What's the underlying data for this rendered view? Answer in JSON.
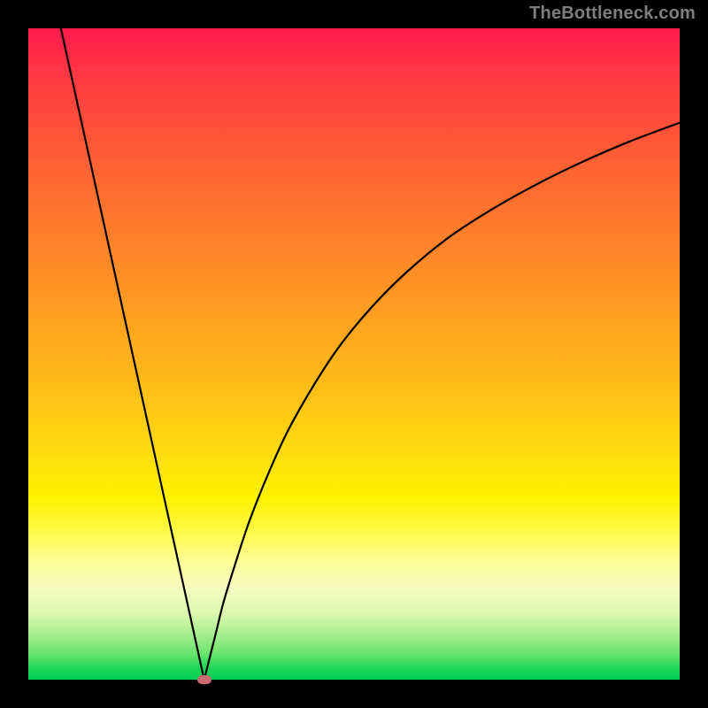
{
  "watermark": "TheBottleneck.com",
  "colors": {
    "frame": "#000000",
    "curve_stroke": "#000000",
    "vertex_fill": "#c96a6c",
    "gradient_top": "#ff1a4d",
    "gradient_bottom": "#00cf55"
  },
  "chart_data": {
    "type": "line",
    "title": "",
    "xlabel": "",
    "ylabel": "",
    "xlim": [
      0,
      100
    ],
    "ylim": [
      0,
      100
    ],
    "grid": false,
    "legend": false,
    "vertex": {
      "x": 27,
      "y": 0
    },
    "series": [
      {
        "name": "left",
        "x": [
          5,
          7.2,
          9.4,
          11.6,
          13.8,
          16,
          18.2,
          20.4,
          22.6,
          24.8,
          27
        ],
        "values": [
          100,
          90,
          80,
          70,
          60,
          50,
          40,
          30,
          20,
          10,
          0
        ]
      },
      {
        "name": "right",
        "x": [
          27,
          28,
          29,
          30,
          32,
          34,
          37,
          40,
          44,
          48,
          53,
          58,
          64,
          70,
          77,
          84,
          92,
          100
        ],
        "values": [
          0,
          4,
          8,
          12,
          18.5,
          24.5,
          32,
          38.5,
          45.5,
          51.5,
          57.5,
          62.5,
          67.5,
          71.5,
          75.5,
          79,
          82.5,
          85.5
        ]
      }
    ]
  }
}
